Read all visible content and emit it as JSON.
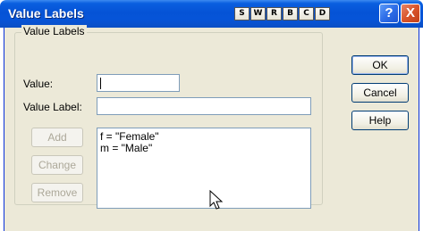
{
  "window": {
    "title": "Value Labels",
    "toolbar_buttons": [
      "S",
      "W",
      "R",
      "B",
      "C",
      "D"
    ],
    "help_glyph": "?",
    "close_glyph": "X"
  },
  "group": {
    "title": "Value Labels",
    "value_label": "Value:",
    "value_input": "",
    "value_label_label": "Value Label:",
    "value_label_input": ""
  },
  "buttons": {
    "ok": "OK",
    "cancel": "Cancel",
    "help": "Help",
    "add": "Add",
    "change": "Change",
    "remove": "Remove"
  },
  "list": {
    "items": [
      "f = \"Female\"",
      "m = \"Male\""
    ]
  },
  "colors": {
    "titlebar": "#0553d6",
    "dialog_background": "#ece9d8"
  },
  "icons": {
    "help": "help-icon",
    "close": "close-icon",
    "cursor": "mouse-pointer-icon"
  }
}
